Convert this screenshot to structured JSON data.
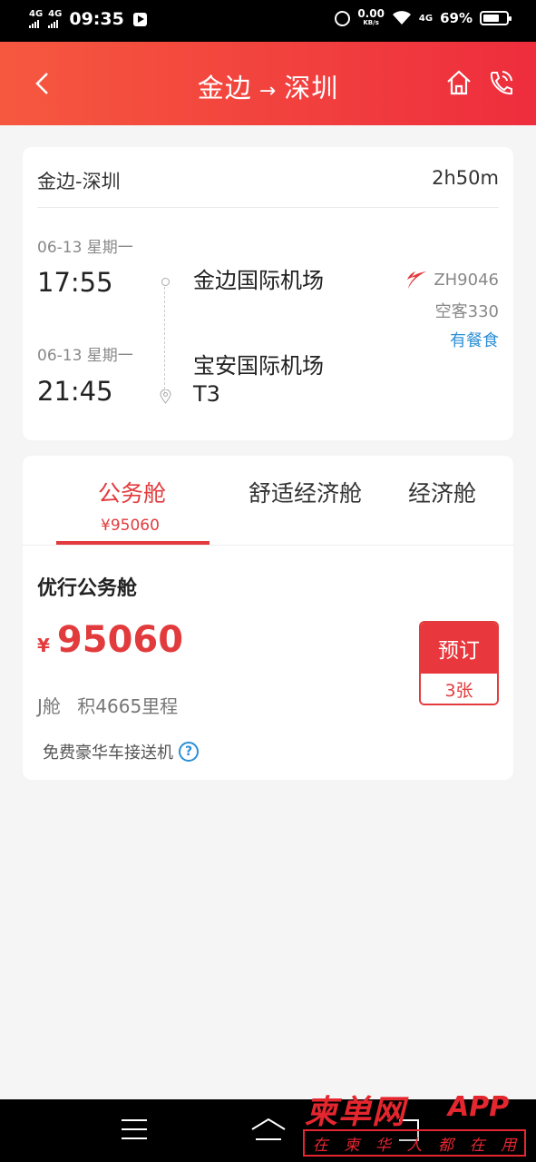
{
  "status_bar": {
    "network1": "4G",
    "network2": "4G",
    "time": "09:35",
    "speed_value": "0.00",
    "speed_unit": "KB/s",
    "signal": "4G",
    "battery": "69%",
    "battery_level": 0.69
  },
  "header": {
    "origin": "金边",
    "arrow": "→",
    "destination": "深圳",
    "icons": [
      "back-icon",
      "home-icon",
      "phone-icon"
    ]
  },
  "flight": {
    "route": "金边-深圳",
    "duration": "2h50m",
    "departure": {
      "date": "06-13 星期一",
      "time": "17:55",
      "airport": "金边国际机场"
    },
    "arrival": {
      "date": "06-13 星期一",
      "time": "21:45",
      "airport": "宝安国际机场T3"
    },
    "flight_no": "ZH9046",
    "aircraft": "空客330",
    "meal": "有餐食"
  },
  "cabin_tabs": [
    {
      "label": "公务舱",
      "price": "¥95060"
    },
    {
      "label": "舒适经济舱"
    },
    {
      "label": "经济舱"
    }
  ],
  "fare": {
    "name": "优行公务舱",
    "currency": "¥",
    "amount": "95060",
    "book_label": "预订",
    "seats_left": "3张",
    "cabin_class": "J舱",
    "mileage": "积4665里程",
    "service": "免费豪华车接送机",
    "help_symbol": "?"
  },
  "watermark": {
    "brand": "柬单网",
    "app": "APP",
    "slogan": [
      "在",
      "柬",
      "华",
      "人",
      "都",
      "在",
      "用"
    ]
  },
  "colors": {
    "accent": "#e23b3d",
    "header_start": "#f6583f",
    "header_end": "#ee2d3d",
    "link": "#2b8fd6"
  }
}
